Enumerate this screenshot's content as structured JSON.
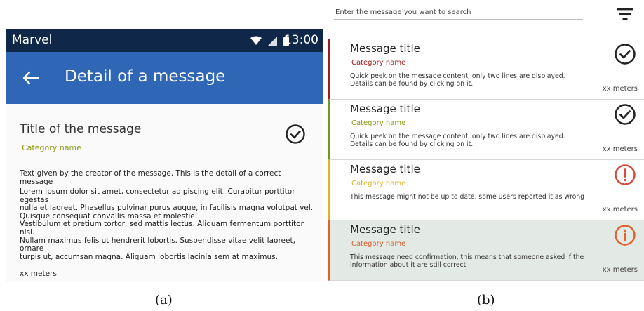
{
  "panel_a": {
    "status_bar": {
      "app_name": "Marvel",
      "time": "13:00",
      "icons": [
        "wifi-icon",
        "signal-icon",
        "battery-icon"
      ]
    },
    "app_bar": {
      "back_icon": "arrow-left-icon",
      "title": "Detail of a message"
    },
    "message": {
      "title": "Title of the message",
      "category": "Category name",
      "status_icon": "check-circle-icon",
      "summary": "Text given by the creator of the message. This is the detail of a correct message",
      "body_lines": [
        "Lorem ipsum dolor sit amet, consectetur adipiscing elit. Curabitur porttitor egestas",
        "nulla et laoreet. Phasellus pulvinar purus augue, in facilisis magna volutpat vel.",
        "Quisque consequat convallis massa et molestie.",
        "Vestibulum et pretium tortor, sed mattis lectus. Aliquam fermentum porttitor nisi.",
        "Nullam maximus felis ut hendrerit lobortis. Suspendisse vitae velit laoreet, ornare",
        "turpis ut, accumsan magna. Aliquam lobortis lacinia sem at maximus."
      ],
      "distance": "xx meters"
    },
    "caption": "(a)"
  },
  "panel_b": {
    "search": {
      "placeholder": "Enter the message you want to search",
      "filter_icon": "filter-icon"
    },
    "messages": [
      {
        "title": "Message title",
        "category": "Category name",
        "preview": "Quick peek on the message content, only two lines are displayed. Details can be found by clicking on it.",
        "distance": "xx meters",
        "status_icon": "check-circle-icon",
        "accent_color": "#a01c1c",
        "category_color": "#a01c1c",
        "icon_color": "#222222",
        "background": "#ffffff"
      },
      {
        "title": "Message title",
        "category": "Category name",
        "preview": "Quick peek on the message content, only two lines are displayed. Details can be found by clicking on it.",
        "distance": "xx meters",
        "status_icon": "check-circle-icon",
        "accent_color": "#6e9a1a",
        "category_color": "#8a9a12",
        "icon_color": "#222222",
        "background": "#ffffff"
      },
      {
        "title": "Message title",
        "category": "Category name",
        "preview": "This message might not be up to date, some users reported it as wrong",
        "distance": "xx meters",
        "status_icon": "exclamation-circle-icon",
        "accent_color": "#e0b41e",
        "category_color": "#e0b41e",
        "icon_color": "#d84a3a",
        "background": "#ffffff"
      },
      {
        "title": "Message title",
        "category": "Category name",
        "preview": "This message need confirmation, this means that someone asked if the information about it are still correct",
        "distance": "xx meters",
        "status_icon": "info-circle-icon",
        "accent_color": "#e0612a",
        "category_color": "#e0612a",
        "icon_color": "#e0612a",
        "background": "#e3e9e4"
      }
    ],
    "caption": "(b)"
  }
}
